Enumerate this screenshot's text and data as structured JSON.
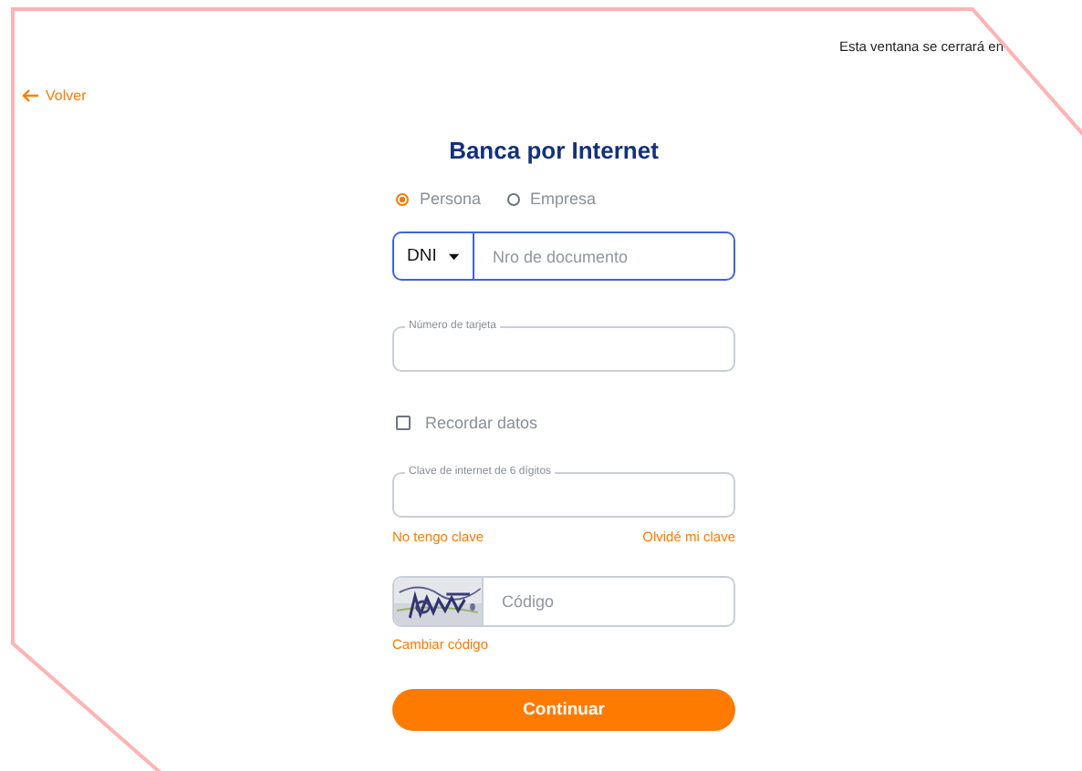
{
  "header": {
    "countdown_text": "Esta ventana se cerrará en"
  },
  "back_link": {
    "label": "Volver"
  },
  "title": "Banca por Internet",
  "client_types": [
    {
      "label": "Persona",
      "selected": true
    },
    {
      "label": "Empresa",
      "selected": false
    }
  ],
  "document": {
    "type": "DNI",
    "placeholder": "Nro de documento",
    "focused": true
  },
  "card_field": {
    "label": "Número de tarjeta"
  },
  "remember": {
    "label": "Recordar datos",
    "checked": false
  },
  "password_field": {
    "label": "Clave de internet de 6 dígitos"
  },
  "links": [
    {
      "label": "No tengo clave"
    },
    {
      "label": "Olvidé mi clave"
    }
  ],
  "captcha": {
    "placeholder": "Código",
    "change_label": "Cambiar código"
  },
  "submit": {
    "label": "Continuar"
  }
}
